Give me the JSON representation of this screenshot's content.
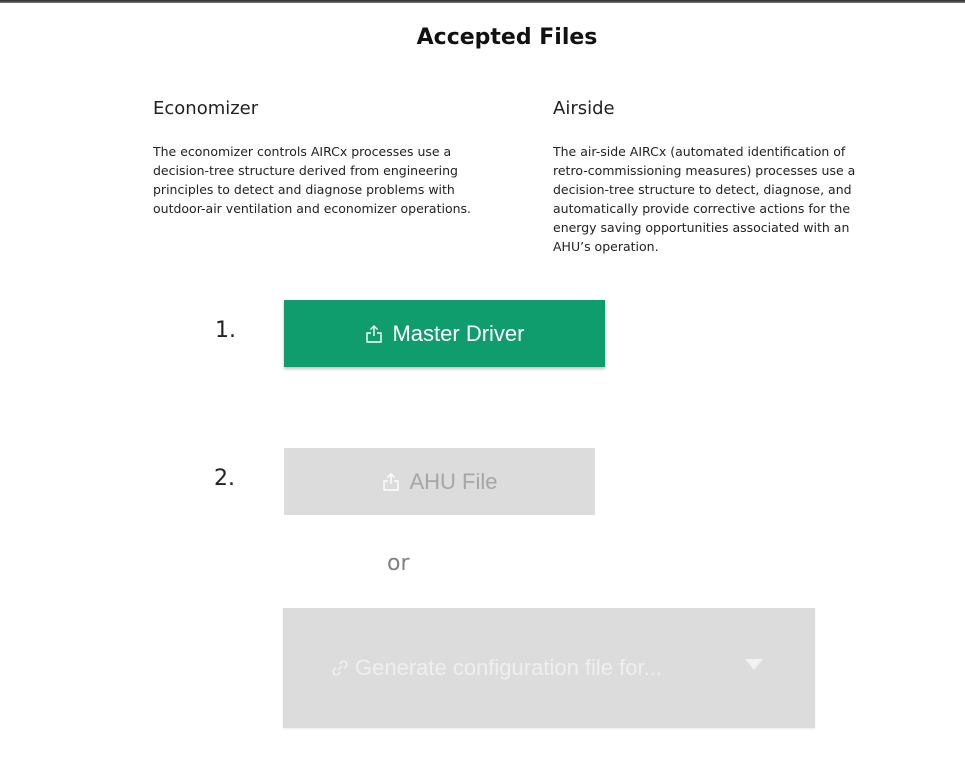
{
  "page": {
    "title": "Accepted Files"
  },
  "cards": {
    "economizer": {
      "title": "Economizer",
      "description": "The economizer controls AIRCx processes use a decision-tree structure derived from engineering principles to detect and diagnose problems with outdoor-air ventilation and economizer operations."
    },
    "airside": {
      "title": "Airside",
      "description": "The air-side AIRCx (automated identification of retro-commissioning measures) processes use a decision-tree structure to detect, diagnose, and automatically provide corrective actions for the energy saving opportunities associated with an AHU’s operation."
    }
  },
  "steps": {
    "step1": {
      "number": "1.",
      "button_label": "Master Driver",
      "icon": "upload-icon",
      "enabled": true
    },
    "step2": {
      "number": "2.",
      "button_label": "AHU File",
      "icon": "upload-icon",
      "enabled": false
    },
    "or_label": "or",
    "generate": {
      "label": "Generate configuration file for...",
      "icon": "link-icon",
      "enabled": false
    }
  },
  "colors": {
    "primary_button": "#0f9d6e",
    "disabled_button": "#dcdcdc",
    "disabled_text": "#a6a6a6"
  }
}
